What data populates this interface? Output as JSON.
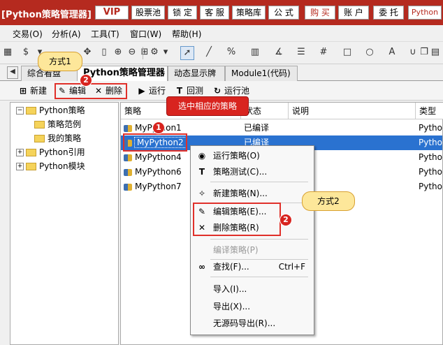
{
  "titlebar": {
    "title": "[Python策略管理器]",
    "buttons": [
      "VIP",
      "股票池",
      "锁 定",
      "客 服",
      "策略库",
      "公 式",
      "购 买",
      "账 户",
      "委 托",
      "Python"
    ]
  },
  "menubar": [
    "交易(O)",
    "分析(A)",
    "工具(T)",
    "窗口(W)",
    "帮助(H)"
  ],
  "toolbar": {
    "dollar": "$",
    "gear": "⚙"
  },
  "tabs": [
    "综合看盘",
    "Python策略管理器",
    "动态显示牌",
    "Module1(代码)"
  ],
  "strategy_toolbar": {
    "new": "新建",
    "edit": "编辑",
    "delete": "删除",
    "run": "运行",
    "backtest": "回测",
    "run_pool": "运行池"
  },
  "tree": {
    "root": "Python策略",
    "children": [
      "策略范例",
      "我的策略"
    ],
    "others": [
      "Python引用",
      "Python模块"
    ]
  },
  "table": {
    "headers": [
      "策略",
      "状态",
      "说明",
      "类型"
    ],
    "rows": [
      {
        "name": "MyPython1",
        "status": "已编译",
        "type": "Python"
      },
      {
        "name": "MyPython2",
        "status": "已编译",
        "type": "Python"
      },
      {
        "name": "MyPython4",
        "status": "",
        "type": "Python"
      },
      {
        "name": "MyPython6",
        "status": "",
        "type": "Python"
      },
      {
        "name": "MyPython7",
        "status": "",
        "type": "Python"
      }
    ],
    "selected_row": 1
  },
  "context_menu": {
    "items": [
      {
        "label": "运行策略(O)",
        "shortcut": ""
      },
      {
        "label": "策略测试(C)...",
        "shortcut": ""
      },
      {
        "label": "新建策略(N)...",
        "shortcut": ""
      },
      {
        "label": "编辑策略(E)...",
        "shortcut": ""
      },
      {
        "label": "删除策略(R)",
        "shortcut": ""
      },
      {
        "label": "编译策略(P)",
        "shortcut": ""
      },
      {
        "label": "查找(F)...",
        "shortcut": "Ctrl+F"
      },
      {
        "label": "导入(I)...",
        "shortcut": ""
      },
      {
        "label": "导出(X)...",
        "shortcut": ""
      },
      {
        "label": "无源码导出(R)...",
        "shortcut": ""
      }
    ]
  },
  "annotations": {
    "way1": "方式1",
    "way2": "方式2",
    "select_hint": "选中相应的策略",
    "badge1": "1",
    "badge2": "2"
  },
  "colors": {
    "title_bg": "#b52a1f",
    "highlight": "#e0302a",
    "callout": "#fde79a",
    "selection": "#2a72d0"
  }
}
